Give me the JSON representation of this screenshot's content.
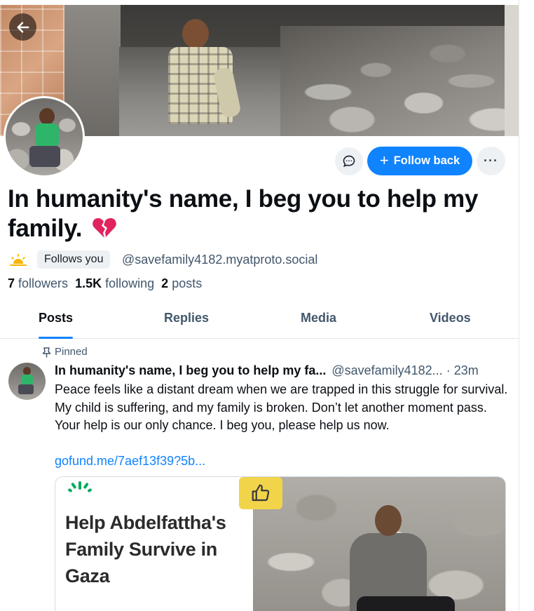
{
  "profile": {
    "display_name": "In humanity's name, I beg you to help my family.",
    "follows_you_label": "Follows you",
    "handle": "@savefamily4182.myatproto.social",
    "followers_count": "7",
    "followers_label": "followers",
    "following_count": "1.5K",
    "following_label": "following",
    "posts_count": "2",
    "posts_label": "posts",
    "heart_emoji": "broken-heart-icon"
  },
  "actions": {
    "follow_back_label": "Follow back",
    "follow_plus": "+",
    "more_label": "···"
  },
  "tabs": [
    {
      "label": "Posts",
      "active": true
    },
    {
      "label": "Replies",
      "active": false
    },
    {
      "label": "Media",
      "active": false
    },
    {
      "label": "Videos",
      "active": false
    }
  ],
  "post": {
    "pinned_label": "Pinned",
    "author_name": "In humanity's name, I beg you to help my fa...",
    "author_handle": "@savefamily4182...",
    "time": "· 23m",
    "text": "Peace feels like a distant dream when we are trapped in this struggle for survival. My child is suffering, and my family is broken. Don’t let another moment pass. Your help is our only chance. I beg you, please help us now.",
    "link": "gofund.me/7aef13f39?5b...",
    "card_title": "Help Abdelfattha's Family Survive in Gaza"
  },
  "colors": {
    "accent": "#1083fe",
    "text_primary": "#0b0f14",
    "text_secondary": "#42576c",
    "chip_bg": "#eef1f4"
  }
}
